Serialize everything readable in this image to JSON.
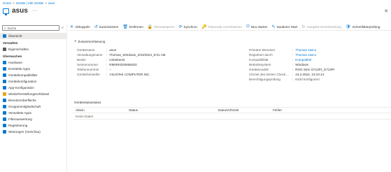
{
  "breadcrumb": [
    "Home",
    "Geräte | Alle Geräte",
    "asus"
  ],
  "header": {
    "title": "asus",
    "more": "···",
    "close": "✕"
  },
  "sidebar": {
    "search_placeholder": "Suche",
    "collapse": "«",
    "items": [
      {
        "label": "Übersicht",
        "active": true,
        "icon": "info-icon",
        "color": "#0078d4"
      },
      {
        "section": "Verwalten"
      },
      {
        "label": "Eigenschaften",
        "icon": "properties-icon",
        "color": "#605e5c"
      },
      {
        "section": "Überwachen"
      },
      {
        "label": "Hardware",
        "icon": "hardware-icon",
        "color": "#0078d4"
      },
      {
        "label": "Ermittelte Apps",
        "icon": "apps-icon",
        "color": "#0078d4"
      },
      {
        "label": "Gerätekompatibilität",
        "icon": "compliance-icon",
        "color": "#0078d4"
      },
      {
        "label": "Gerätekonfiguration",
        "icon": "configuration-icon",
        "color": "#0078d4"
      },
      {
        "label": "App-Konfiguration",
        "icon": "app-config-icon",
        "color": "#0078d4"
      },
      {
        "label": "Wiederherstellungsschlüssel",
        "icon": "key-icon",
        "color": "#e8a317"
      },
      {
        "label": "Benutzeroberfläche",
        "icon": "user-experience-icon",
        "color": "#0078d4"
      },
      {
        "label": "Gruppenmitgliedschaft",
        "icon": "group-icon",
        "color": "#0078d4"
      },
      {
        "label": "Verwaltete Apps",
        "icon": "managed-apps-icon",
        "color": "#0078d4"
      },
      {
        "label": "Filterauswertung",
        "icon": "filter-icon",
        "color": "#0078d4"
      },
      {
        "label": "Registrierung",
        "icon": "enrollment-icon",
        "color": "#0078d4"
      },
      {
        "label": "Wartungen (Vorschau)",
        "icon": "maintenance-icon",
        "color": "#0078d4"
      }
    ]
  },
  "toolbar": [
    {
      "label": "Abkoppeln",
      "icon": "✕",
      "disabled": false,
      "name": "retire-button"
    },
    {
      "label": "Zurücksetzen",
      "icon": "↺",
      "disabled": false,
      "name": "wipe-button"
    },
    {
      "label": "Entfernen",
      "icon": "🗑",
      "disabled": false,
      "name": "delete-button"
    },
    {
      "label": "Remotesperre",
      "icon": "🔒",
      "disabled": true,
      "name": "remote-lock-button"
    },
    {
      "label": "Synchron",
      "icon": "⟳",
      "disabled": false,
      "name": "sync-button"
    },
    {
      "label": "Passcode zurücksetzen",
      "icon": "🔑",
      "disabled": true,
      "name": "reset-passcode-button"
    },
    {
      "label": "Neu starten",
      "icon": "⏻",
      "disabled": false,
      "name": "restart-button"
    },
    {
      "label": "Sauberer Start",
      "icon": "✎",
      "disabled": false,
      "name": "fresh-start-button"
    },
    {
      "label": "Autopilot-Zurücksetzung",
      "icon": "↻",
      "disabled": true,
      "name": "autopilot-reset-button"
    },
    {
      "label": "Schnellüberprüfung",
      "icon": "🛡",
      "disabled": false,
      "name": "quick-scan-button"
    }
  ],
  "essentials": {
    "label": "Zusammenfassung",
    "chevron": "∨"
  },
  "left_fields": [
    {
      "label": "Gerätename",
      "value": "asus",
      "link": false
    },
    {
      "label": "Verwaltungsname",
      "value": "Thomas_Windows_2/23/2024_8:01 AM",
      "link": false
    },
    {
      "label": "Besitz",
      "value": "Unbekannt",
      "link": false
    },
    {
      "label": "Seriennummer",
      "value": "R8NRKD00658203",
      "link": false
    },
    {
      "label": "Telefonnummer",
      "value": "--",
      "link": false
    },
    {
      "label": "Gerätehersteller",
      "value": "ASUSTeK COMPUTER INC.",
      "link": false
    }
  ],
  "right_fields": [
    {
      "label": "Primärer Benutzer",
      "value": "Thomas Jasco",
      "link": true
    },
    {
      "label": "Registriert durch",
      "value": "Thomas Jasco",
      "link": true
    },
    {
      "label": "Kompatibilität",
      "value": "Kompatibel",
      "link": true
    },
    {
      "label": "Betriebssystem",
      "value": "Windows",
      "link": false
    },
    {
      "label": "Gerätemodell",
      "value": "ROG Strix G713PI_G713PI",
      "link": false
    },
    {
      "label": "Uhrzeit des letzten Check…",
      "value": "23.2.2024, 10:10:14",
      "link": false
    },
    {
      "label": "Berechtigungsprüfung",
      "value": "Nicht konfiguriert",
      "link": false,
      "muted": true
    }
  ],
  "status": {
    "title": "Gerätestatusstatus",
    "columns": [
      "Aktion",
      "Status",
      "Datum/Uhrzeit",
      "Fehler"
    ],
    "empty": "Keine Daten"
  }
}
